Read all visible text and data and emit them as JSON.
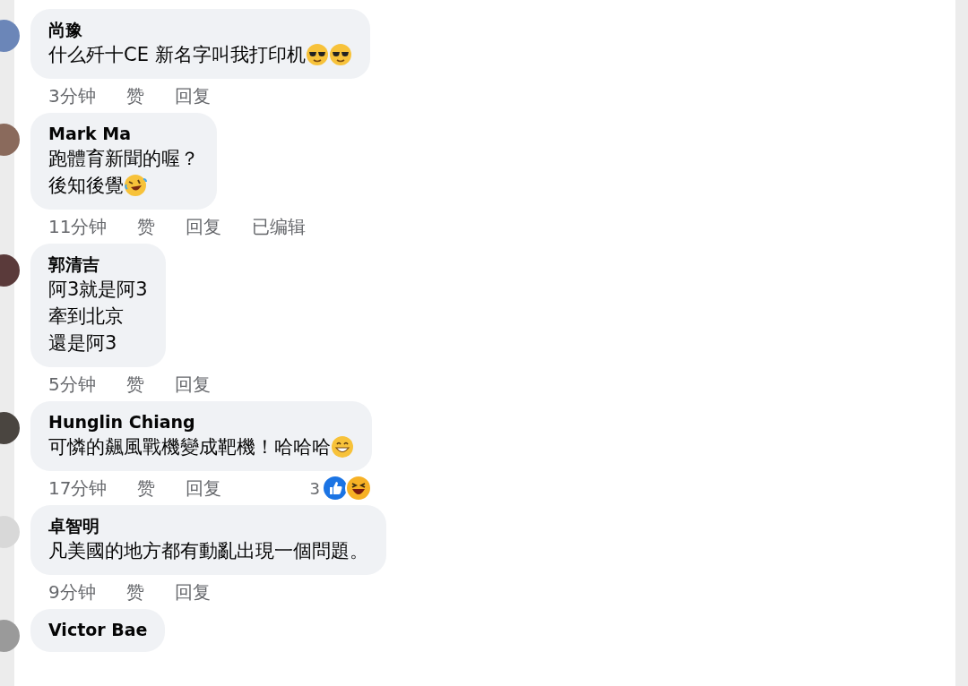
{
  "comments": [
    {
      "name": "尚豫",
      "lines": [
        {
          "text": "什么歼十CE 新名字叫我打印机",
          "emoji": [
            {
              "kind": "cool"
            },
            {
              "kind": "cool"
            }
          ]
        }
      ],
      "meta": [
        "3分钟",
        "赞",
        "回复"
      ]
    },
    {
      "name": "Mark Ma",
      "lines": [
        {
          "text": "跑體育新聞的喔？"
        },
        {
          "text": "後知後覺",
          "emoji": [
            {
              "kind": "rofl"
            }
          ]
        }
      ],
      "meta": [
        "11分钟",
        "赞",
        "回复",
        "已编辑"
      ]
    },
    {
      "name": "郭清吉",
      "lines": [
        {
          "text": "阿3就是阿3"
        },
        {
          "text": "牽到北京"
        },
        {
          "text": "還是阿3"
        }
      ],
      "meta": [
        "5分钟",
        "赞",
        "回复"
      ]
    },
    {
      "name": "Hunglin Chiang",
      "lines": [
        {
          "text": "可憐的飆風戰機變成靶機！哈哈哈",
          "emoji": [
            {
              "kind": "smile"
            }
          ]
        }
      ],
      "meta": [
        "17分钟",
        "赞",
        "回复"
      ],
      "reactions": {
        "count": "3",
        "icons": [
          {
            "kind": "like"
          },
          {
            "kind": "haha"
          }
        ]
      }
    },
    {
      "name": "卓智明",
      "lines": [
        {
          "text": "凡美國的地方都有動亂出現一個問題。"
        }
      ],
      "meta": [
        "9分钟",
        "赞",
        "回复"
      ]
    },
    {
      "name": "Victor Bae"
    }
  ]
}
